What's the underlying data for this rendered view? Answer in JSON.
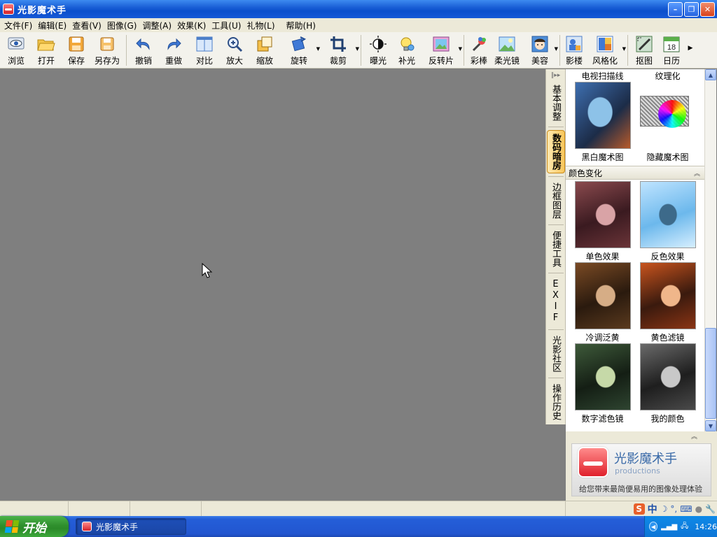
{
  "window": {
    "title": "光影魔术手"
  },
  "menu": [
    "文件(F)",
    "编辑(E)",
    "查看(V)",
    "图像(G)",
    "调整(A)",
    "效果(K)",
    "工具(U)",
    "礼物(L)",
    "帮助(H)"
  ],
  "toolbar": {
    "browse": "浏览",
    "open": "打开",
    "save": "保存",
    "save_as": "另存为",
    "undo": "撤销",
    "redo": "重做",
    "compare": "对比",
    "zoom_in": "放大",
    "resize": "缩放",
    "rotate": "旋转",
    "crop": "裁剪",
    "exposure": "曝光",
    "fill_light": "补光",
    "reversal": "反转片",
    "color_pen": "彩棒",
    "soft_focus": "柔光镜",
    "beauty": "美容",
    "studio": "影楼",
    "stylize": "风格化",
    "cutout": "抠图",
    "calendar": "日历",
    "calendar_day": "18"
  },
  "side_tabs": [
    {
      "label": "基本调整",
      "active": false
    },
    {
      "label": "数码暗房",
      "active": true
    },
    {
      "label": "边框图层",
      "active": false
    },
    {
      "label": "便捷工具",
      "active": false
    },
    {
      "label": "EXIF",
      "active": false
    },
    {
      "label": "光影社区",
      "active": false
    },
    {
      "label": "操作历史",
      "active": false
    }
  ],
  "panel": {
    "top_captions": {
      "left": "电视扫描线",
      "right": "纹理化"
    },
    "row1": [
      {
        "label": "黑白魔术图"
      },
      {
        "label": "隐藏魔术图"
      }
    ],
    "section_title": "颜色变化",
    "row2": [
      {
        "label": "单色效果"
      },
      {
        "label": "反色效果"
      }
    ],
    "row3": [
      {
        "label": "冷调泛黄"
      },
      {
        "label": "黄色滤镜"
      }
    ],
    "row4": [
      {
        "label": "数字滤色镜"
      },
      {
        "label": "我的颜色"
      }
    ]
  },
  "brand": {
    "name": "光影魔术手",
    "sub": "productions",
    "slogan": "给您带来最简便易用的图像处理体验"
  },
  "ime": {
    "zh": "中"
  },
  "taskbar": {
    "start": "开始",
    "task": "光影魔术手",
    "clock": "14:26"
  },
  "colors": {
    "accent": "#0b4fcc",
    "tab_active": "#f8c65a",
    "canvas": "#7f7f7f"
  }
}
